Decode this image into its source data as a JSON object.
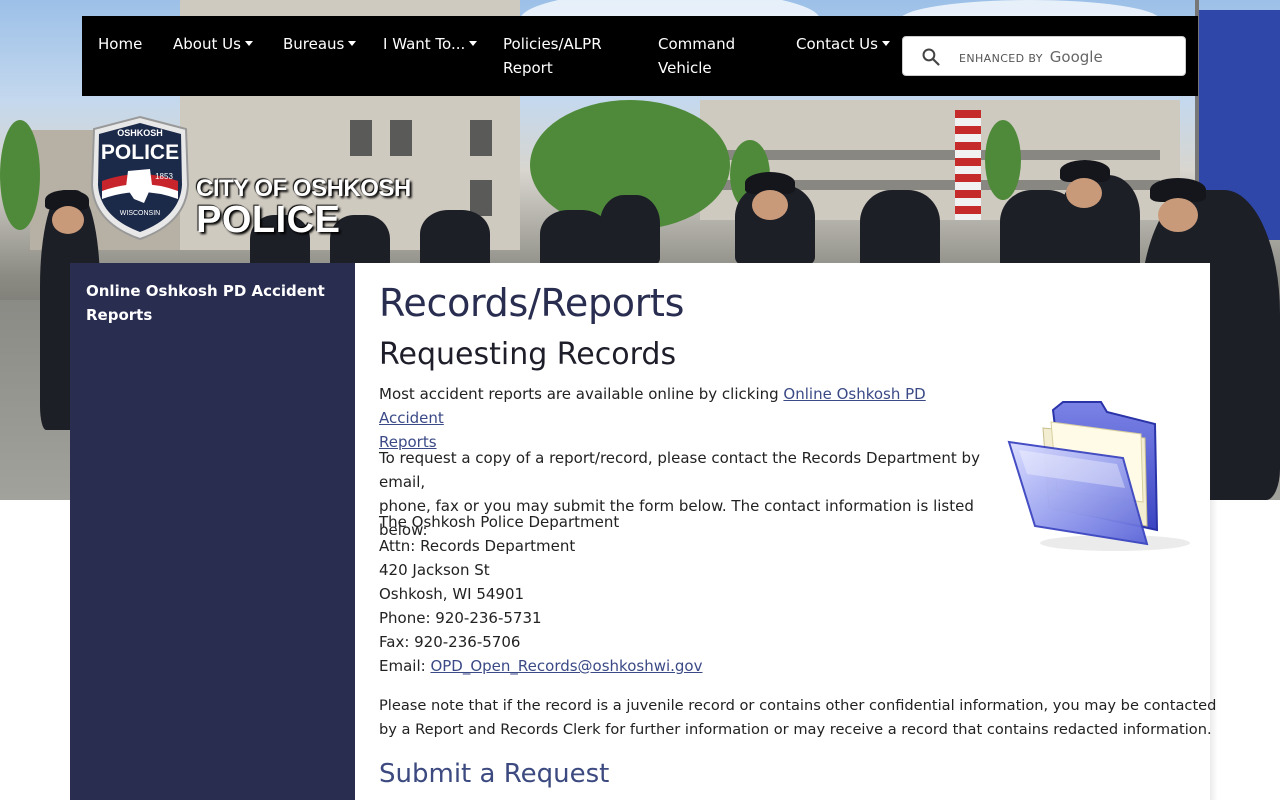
{
  "nav": {
    "items": [
      {
        "label": "Home",
        "dropdown": false
      },
      {
        "label": "About Us",
        "dropdown": true
      },
      {
        "label": "Bureaus",
        "dropdown": true
      },
      {
        "label": "I Want To...",
        "dropdown": true
      },
      {
        "label": "Policies/ALPR Report",
        "dropdown": false
      },
      {
        "label": "Command Vehicle",
        "dropdown": false
      },
      {
        "label": "Contact Us",
        "dropdown": true
      }
    ],
    "policies_line1": "Policies/ALPR",
    "policies_line2": "Report",
    "command_line1": "Command",
    "command_line2": "Vehicle"
  },
  "search": {
    "brand_prefix": "ENHANCED BY",
    "brand_name": "Google",
    "placeholder": ""
  },
  "logo": {
    "badge_top": "OSHKOSH",
    "badge_main": "POLICE",
    "badge_year": "1853",
    "badge_state": "WISCONSIN",
    "line1": "CITY OF OSHKOSH",
    "line2": "POLICE"
  },
  "sidebar": {
    "items": [
      {
        "label": "Online Oshkosh PD Accident Reports"
      }
    ]
  },
  "main": {
    "title": "Records/Reports",
    "subtitle": "Requesting Records",
    "intro_text": "Most accident reports are available online by clicking ",
    "intro_link": "Online Oshkosh PD Accident",
    "intro_link2": "Reports",
    "request_line1": "To request a copy of a report/record, please contact the Records Department by email,",
    "request_line2": "phone, fax or you may submit the form below. The contact information is listed below:",
    "address": {
      "org": "The Oshkosh Police Department",
      "attn": "Attn: Records Department",
      "street": "420 Jackson St",
      "city": "Oshkosh, WI 54901",
      "phone": "Phone: 920-236-5731",
      "fax": "Fax: 920-236-5706",
      "email_label": "Email: ",
      "email": "OPD_Open_Records@oshkoshwi.gov"
    },
    "note_line1": "Please note that if the record is a juvenile record or contains other confidential information, you may be contacted",
    "note_line2": "by a Report and Records Clerk for further information or may receive a record that contains redacted information.",
    "submit_title": "Submit a Request"
  },
  "colors": {
    "navbar": "#000000",
    "sidebar": "#292d50",
    "title": "#292d50",
    "link": "#3b4a86"
  }
}
